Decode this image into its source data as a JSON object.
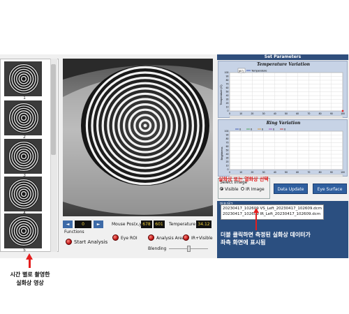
{
  "thumbnails": {
    "numbers": [
      "1",
      "2",
      "3",
      "4",
      "5"
    ]
  },
  "controls": {
    "nav_prev": "◄",
    "nav_next": "►",
    "frame_value": "0",
    "mouse_pos_label": "Mouse Pos(x,y)",
    "mouse_x": "678",
    "mouse_y": "601",
    "temperature_label": "Temperature",
    "temperature_value": "34.12",
    "functions_label": "Functions",
    "start_analysis": "Start Analysis",
    "eye_roi": "Eye ROI",
    "analysis_area": "Analysis Area",
    "ir_visible": "IR+Visible",
    "blending": "Blending"
  },
  "right_panel": {
    "title": "Set Parameters",
    "temp_chart": {
      "title": "Temperature Variation",
      "legend_box": "[87]",
      "legend_series": "Temperature",
      "ylabel": "Temperature (C)"
    },
    "ring_chart": {
      "title": "Ring Variation",
      "legend": [
        "0",
        "0",
        "0",
        "0",
        "0"
      ],
      "ylabel": "Brightness"
    },
    "select_image_label": "Select Image",
    "visible": "Visible",
    "ir_image": "IR Image",
    "data_update": "Data Update",
    "eye_surface": "Eye Surface",
    "list_label": "번호/목2",
    "list_items": [
      "20230417_102609 VS_Left_20230417_102609.dcm",
      "20230417_102609 IR_Left_20230417_102609.dcm"
    ]
  },
  "annotations": {
    "select_hint": "실화상 또는 열화상 선택",
    "double_click_line1": "더블 클릭하면 측정된 실화상 데이터가",
    "double_click_line2": "좌측 화면에 표시됨",
    "time_line1": "시간 별로 촬영한",
    "time_line2": "실화상 영상"
  },
  "chart_data": [
    {
      "type": "line",
      "title": "Temperature Variation",
      "ylabel": "Temperature (C)",
      "xlim": [
        0,
        100
      ],
      "ylim": [
        0,
        100
      ],
      "x_ticks": [
        0,
        10,
        20,
        30,
        40,
        50,
        60,
        70,
        80,
        90,
        100
      ],
      "y_ticks": [
        0,
        10,
        20,
        30,
        40,
        50,
        60,
        70,
        80,
        90,
        100
      ],
      "series": [
        {
          "name": "Temperature",
          "x": [
            100
          ],
          "y": [
            0
          ]
        }
      ],
      "grid": true
    },
    {
      "type": "line",
      "title": "Ring Variation",
      "ylabel": "Brightness",
      "xlim": [
        0,
        100
      ],
      "ylim": [
        0,
        100
      ],
      "x_ticks": [
        0,
        10,
        20,
        30,
        40,
        50,
        60,
        70,
        80,
        90,
        100
      ],
      "y_ticks": [
        0,
        10,
        20,
        30,
        40,
        50,
        60,
        70,
        80,
        90,
        100
      ],
      "series": [],
      "grid": true
    }
  ],
  "colors": {
    "accent_blue": "#2f5f9f",
    "title_bar": "#2f4e7c",
    "chart_bg": "#c7d3e6",
    "annotation_red": "#e41e1e",
    "readout_yellow": "#f5d33a"
  }
}
